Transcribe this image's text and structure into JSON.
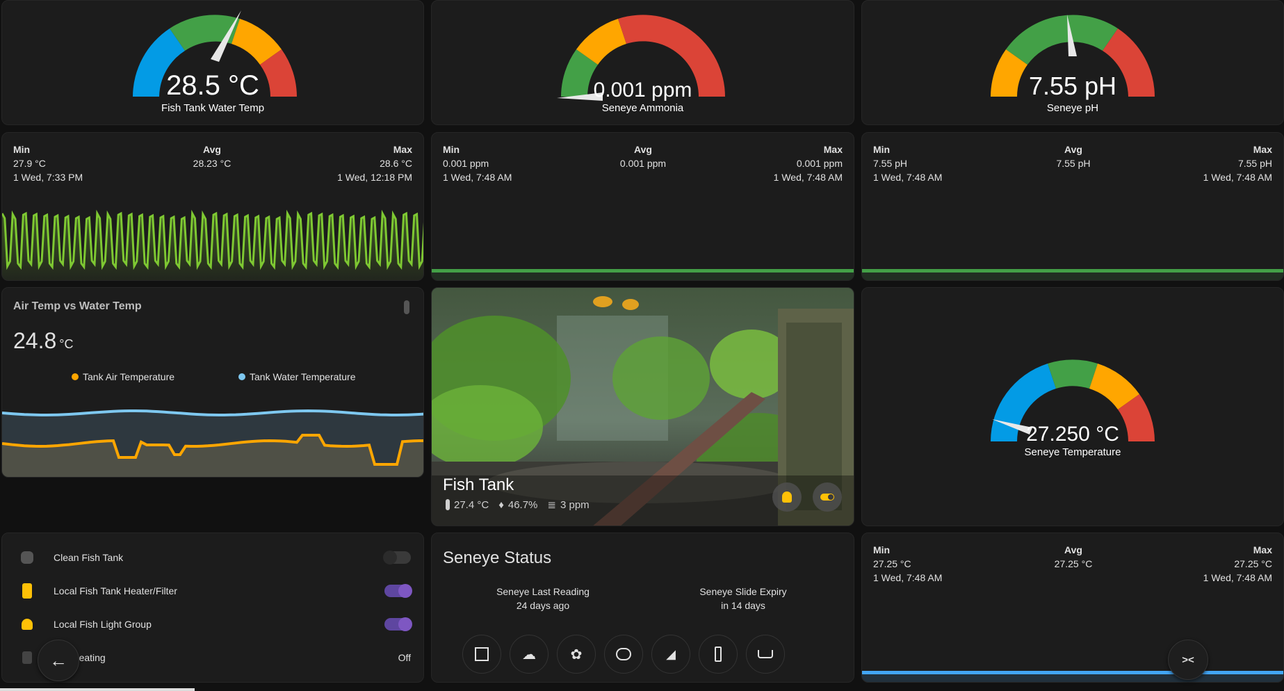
{
  "gauges": {
    "water_temp": {
      "value": "28.5 °C",
      "name": "Fish Tank Water Temp",
      "level": 0.61
    },
    "ammonia": {
      "value": "0.001 ppm",
      "name": "Seneye Ammonia",
      "level": 0.0
    },
    "ph": {
      "value": "7.55 pH",
      "name": "Seneye pH",
      "level": 0.46
    },
    "seneye_temp": {
      "value": "27.250 °C",
      "name": "Seneye Temperature",
      "level": 0.1
    }
  },
  "stats": {
    "water_temp": {
      "min_label": "Min",
      "min_value": "27.9 °C",
      "min_time": "1 Wed, 7:33 PM",
      "avg_label": "Avg",
      "avg_value": "28.23 °C",
      "max_label": "Max",
      "max_value": "28.6 °C",
      "max_time": "1 Wed, 12:18 PM",
      "color": "#7ec832"
    },
    "ammonia": {
      "min_label": "Min",
      "min_value": "0.001 ppm",
      "min_time": "1 Wed, 7:48 AM",
      "avg_label": "Avg",
      "avg_value": "0.001 ppm",
      "max_label": "Max",
      "max_value": "0.001 ppm",
      "max_time": "1 Wed, 7:48 AM",
      "color": "#43a047"
    },
    "ph": {
      "min_label": "Min",
      "min_value": "7.55 pH",
      "min_time": "1 Wed, 7:48 AM",
      "avg_label": "Avg",
      "avg_value": "7.55 pH",
      "max_label": "Max",
      "max_value": "7.55 pH",
      "max_time": "1 Wed, 7:48 AM",
      "color": "#43a047"
    },
    "seneye_temp": {
      "min_label": "Min",
      "min_value": "27.25 °C",
      "min_time": "1 Wed, 7:48 AM",
      "avg_label": "Avg",
      "avg_value": "27.25 °C",
      "max_label": "Max",
      "max_value": "27.25 °C",
      "max_time": "1 Wed, 7:48 AM",
      "color": "#42a5f5"
    }
  },
  "air_vs_water": {
    "title": "Air Temp vs Water Temp",
    "value": "24.8",
    "unit": "°C",
    "legend_air": "Tank Air Temperature",
    "legend_water": "Tank Water Temperature",
    "air_color": "#ffa600",
    "water_color": "#7ec8f0"
  },
  "picture": {
    "title": "Fish Tank",
    "temp": "27.4 °C",
    "humidity": "46.7%",
    "ppm": "3 ppm"
  },
  "entities": [
    {
      "name": "Clean Fish Tank",
      "state": "off",
      "icon": "hand-wash-icon"
    },
    {
      "name": "Local Fish Tank Heater/Filter",
      "state": "on",
      "icon": "power-socket-icon"
    },
    {
      "name": "Local Fish Light Group",
      "state": "on",
      "icon": "lightbulb-group-icon"
    },
    {
      "name": "ank Heating",
      "state": "Off",
      "icon": "heat-off-icon"
    }
  ],
  "seneye_status": {
    "title": "Seneye Status",
    "last_reading_label": "Seneye Last Reading",
    "last_reading_value": "24 days ago",
    "slide_expiry_label": "Seneye Slide Expiry",
    "slide_expiry_value": "in 14 days"
  },
  "nav_buttons": [
    "floor-plan-icon",
    "weather-icon",
    "flower-icon",
    "fishbowl-icon",
    "cctv-icon",
    "remote-icon",
    "bath-icon"
  ],
  "colors": {
    "accent_purple": "#7e57c2",
    "toggle_off": "#3a3a3a",
    "gauge_blue": "#039be5",
    "gauge_green": "#43a047",
    "gauge_orange": "#ffa600",
    "gauge_red": "#db4437"
  }
}
